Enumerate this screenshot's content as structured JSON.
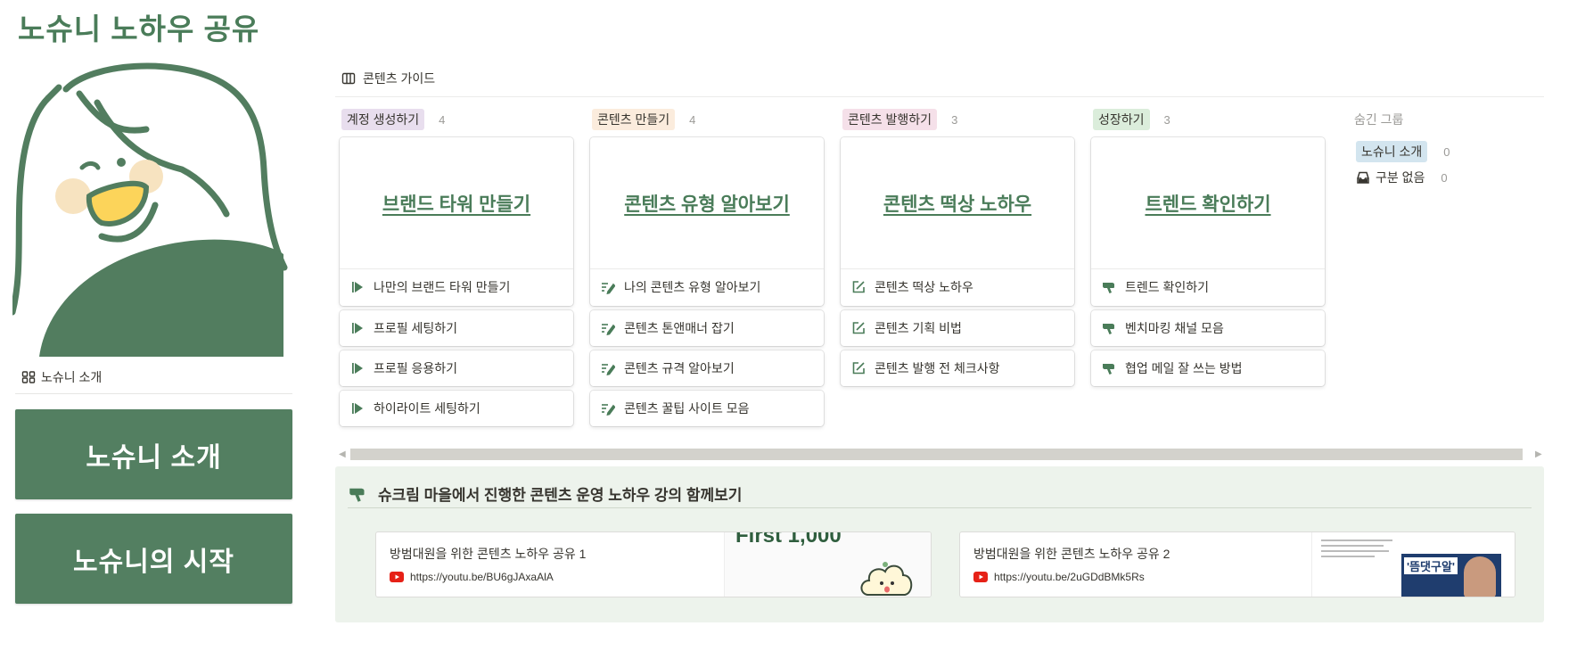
{
  "page_title": "노슈니 노하우 공유",
  "left": {
    "intro_link": "노슈니 소개",
    "buttons": [
      "노슈니 소개",
      "노슈니의 시작"
    ]
  },
  "board": {
    "title": "콘텐츠 가이드",
    "columns": [
      {
        "tag": "계정 생성하기",
        "tag_color": "#e8deee",
        "count": "4",
        "cover": "브랜드 타워 만들기",
        "icon": "flag-icon",
        "items": [
          "나만의 브랜드 타워 만들기",
          "프로필 세팅하기",
          "프로필 응용하기",
          "하이라이트 세팅하기"
        ]
      },
      {
        "tag": "콘텐츠 만들기",
        "tag_color": "#fbecdd",
        "count": "4",
        "cover": "콘텐츠 유형 알아보기",
        "icon": "edit-lines-icon",
        "items": [
          "나의 콘텐츠 유형 알아보기",
          "콘텐츠 톤앤매너 잡기",
          "콘텐츠 규격 알아보기",
          "콘텐츠 꿀팁 사이트 모음"
        ]
      },
      {
        "tag": "콘텐츠 발행하기",
        "tag_color": "#f5e0e9",
        "count": "3",
        "cover": "콘텐츠 떡상 노하우",
        "icon": "edit-box-icon",
        "items": [
          "콘텐츠 떡상 노하우",
          "콘텐츠 기획 비법",
          "콘텐츠 발행 전 체크사항"
        ]
      },
      {
        "tag": "성장하기",
        "tag_color": "#dbeddb",
        "count": "3",
        "cover": "트렌드 확인하기",
        "icon": "pointer-hand-icon",
        "items": [
          "트렌드 확인하기",
          "벤치마킹 채널 모음",
          "협업 메일 잘 쓰는 방법"
        ]
      }
    ],
    "hidden_group": {
      "label": "숨긴 그룹",
      "items": [
        {
          "label": "노슈니 소개",
          "count": "0",
          "tag_color": "#d3e5ef"
        },
        {
          "label": "구분 없음",
          "count": "0"
        }
      ]
    }
  },
  "callout": {
    "title": "슈크림 마을에서 진행한 콘텐츠 운영 노하우 강의 함께보기",
    "bookmarks": [
      {
        "title": "방범대원을 위한 콘텐츠 노하우 공유 1",
        "url": "https://youtu.be/BU6gJAxaAlA",
        "thumb_text": "First 1,000"
      },
      {
        "title": "방범대원을 위한 콘텐츠 노하우 공유 2",
        "url": "https://youtu.be/2uGDdBMk5Rs",
        "thumb_text": "'뜸댓구알'"
      }
    ]
  }
}
